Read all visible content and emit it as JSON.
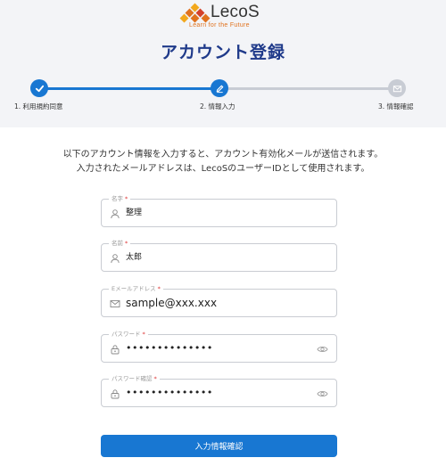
{
  "brand": {
    "name": "LecoS",
    "tagline": "Learn for the Future",
    "colors": {
      "orange": "#e0721e",
      "red": "#d4412a",
      "yellow": "#f2a81d"
    }
  },
  "page": {
    "title": "アカウント登録"
  },
  "stepper": {
    "accent": "#1877d2",
    "inactive": "#c8ccd4",
    "steps": [
      {
        "label": "1. 利用規約同意",
        "state": "done",
        "icon": "check-icon"
      },
      {
        "label": "2. 情報入力",
        "state": "current",
        "icon": "pencil-icon"
      },
      {
        "label": "3. 情報確認",
        "state": "todo",
        "icon": "mail-icon"
      }
    ]
  },
  "intro": {
    "line1": "以下のアカウント情報を入力すると、アカウント有効化メールが送信されます。",
    "line2": "入力されたメールアドレスは、LecoSのユーザーIDとして使用されます。"
  },
  "form": {
    "required_mark": "*",
    "last_name": {
      "label": "名字",
      "value": "整理",
      "icon": "person-icon"
    },
    "first_name": {
      "label": "名前",
      "value": "太郎",
      "icon": "person-icon"
    },
    "email": {
      "label": "Eメールアドレス",
      "value": "sample@xxx.xxx",
      "icon": "mail-icon"
    },
    "password": {
      "label": "パスワード",
      "value": "••••••••••••••",
      "icon": "lock-icon"
    },
    "password_confirm": {
      "label": "パスワード確認",
      "value": "••••••••••••••",
      "icon": "lock-icon"
    },
    "submit_label": "入力情報確認"
  }
}
